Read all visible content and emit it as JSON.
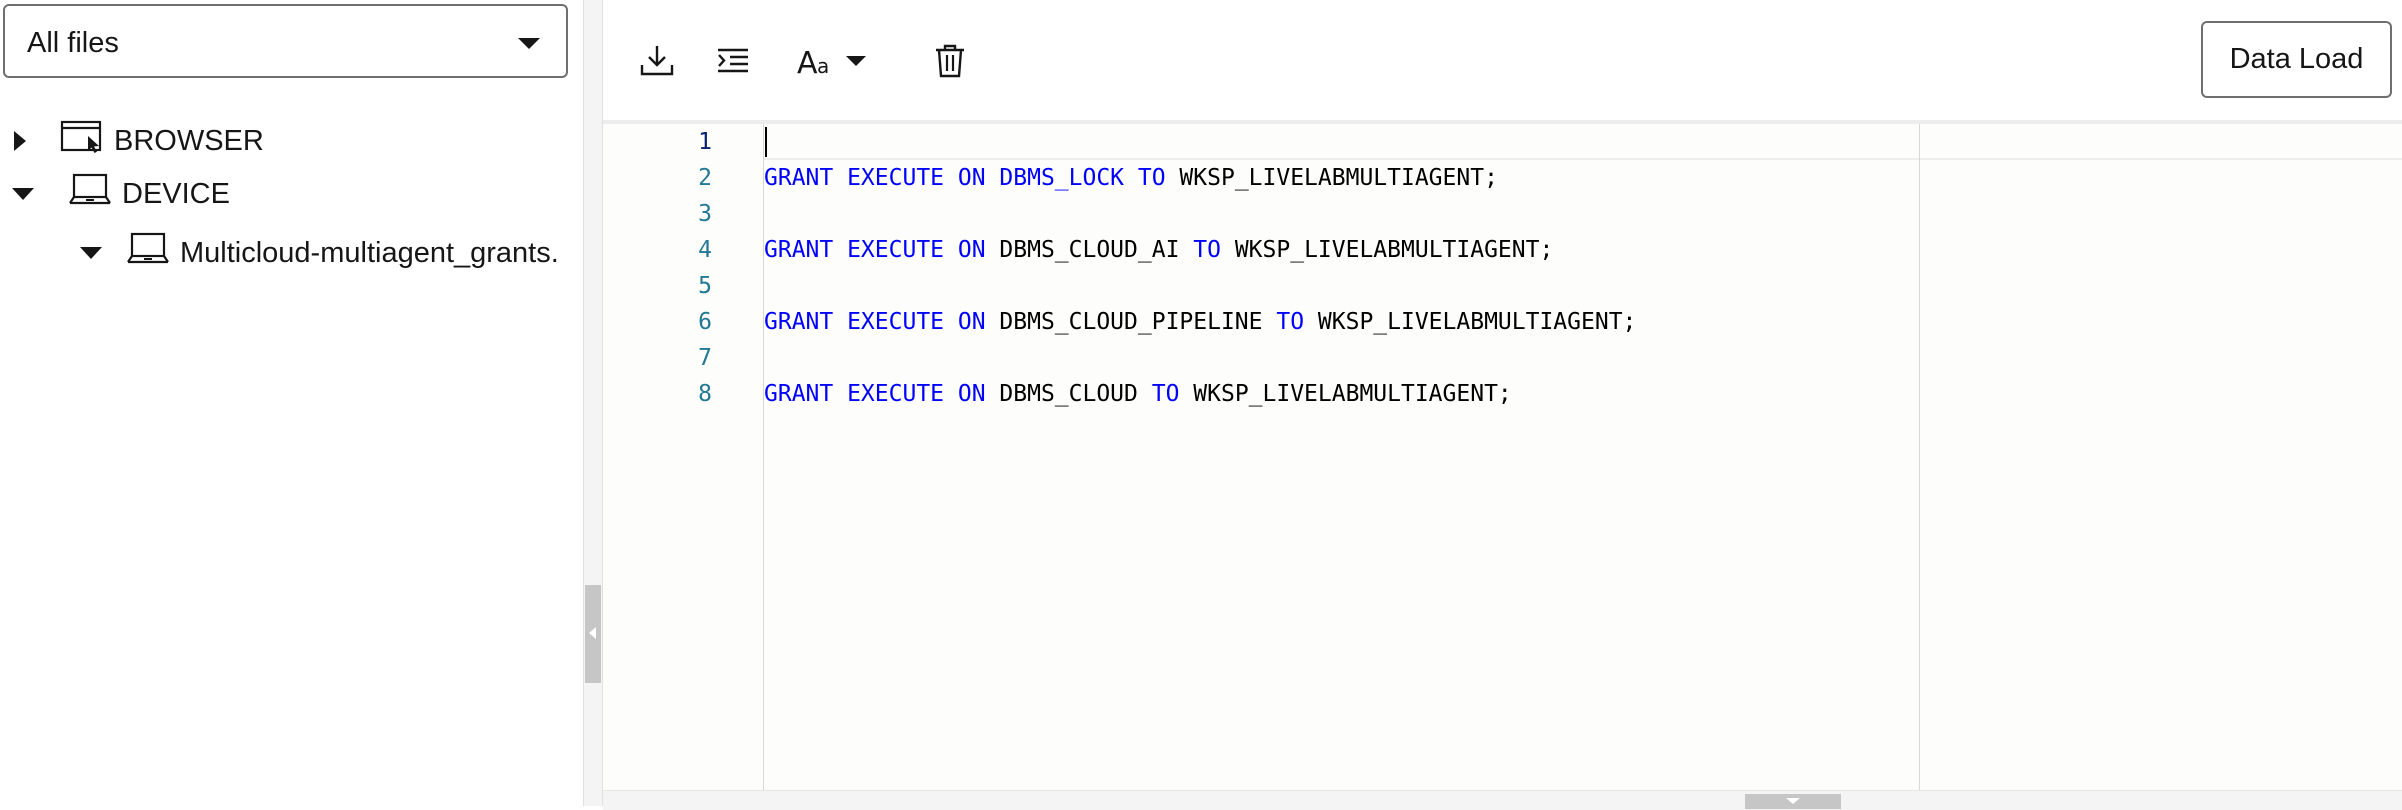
{
  "file_filter": {
    "selected": "All files",
    "icon": "chevron-down-icon"
  },
  "tree": {
    "browser": {
      "label": "BROWSER",
      "expanded": false,
      "icon": "browser-window-icon"
    },
    "device": {
      "label": "DEVICE",
      "expanded": true,
      "icon": "laptop-icon"
    },
    "file": {
      "label": "Multicloud-multiagent_grants.",
      "expanded": true,
      "icon": "laptop-icon"
    }
  },
  "toolbar": {
    "download_icon": "download-icon",
    "format_icon": "format-indent-icon",
    "font_icon": "font-size-icon",
    "delete_icon": "trash-icon",
    "data_load_label": "Data Load"
  },
  "editor": {
    "lines": [
      {
        "number": "1",
        "tokens": []
      },
      {
        "number": "2",
        "tokens": [
          {
            "text": "GRANT EXECUTE ON DBMS_LOCK TO",
            "kind": "keyword"
          },
          {
            "text": " WKSP_LIVELABMULTIAGENT;",
            "kind": "plain"
          }
        ]
      },
      {
        "number": "3",
        "tokens": []
      },
      {
        "number": "4",
        "tokens": [
          {
            "text": "GRANT EXECUTE ON",
            "kind": "keyword"
          },
          {
            "text": " DBMS_CLOUD_AI ",
            "kind": "plain"
          },
          {
            "text": "TO",
            "kind": "keyword"
          },
          {
            "text": " WKSP_LIVELABMULTIAGENT;",
            "kind": "plain"
          }
        ]
      },
      {
        "number": "5",
        "tokens": []
      },
      {
        "number": "6",
        "tokens": [
          {
            "text": "GRANT EXECUTE ON",
            "kind": "keyword"
          },
          {
            "text": " DBMS_CLOUD_PIPELINE ",
            "kind": "plain"
          },
          {
            "text": "TO",
            "kind": "keyword"
          },
          {
            "text": " WKSP_LIVELABMULTIAGENT;",
            "kind": "plain"
          }
        ]
      },
      {
        "number": "7",
        "tokens": []
      },
      {
        "number": "8",
        "tokens": [
          {
            "text": "GRANT EXECUTE ON",
            "kind": "keyword"
          },
          {
            "text": " DBMS_CLOUD ",
            "kind": "plain"
          },
          {
            "text": "TO",
            "kind": "keyword"
          },
          {
            "text": " WKSP_LIVELABMULTIAGENT;",
            "kind": "plain"
          }
        ]
      }
    ],
    "colors": {
      "keyword": "#0000ff",
      "plain": "#000000",
      "line_number": "#237893"
    }
  }
}
